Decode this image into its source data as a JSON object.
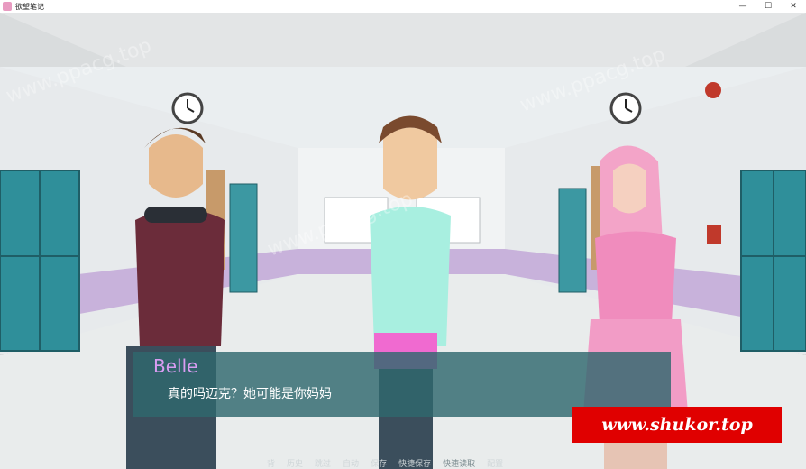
{
  "window": {
    "title": "欲望笔记",
    "controls": [
      "—",
      "☐",
      "✕"
    ]
  },
  "dialogue": {
    "speaker": "Belle",
    "text": "真的吗迈克？她可能是你妈妈"
  },
  "quick_menu": [
    {
      "label": "背",
      "enabled": true
    },
    {
      "label": "历史",
      "enabled": true
    },
    {
      "label": "跳过",
      "enabled": true
    },
    {
      "label": "自动",
      "enabled": true
    },
    {
      "label": "保存",
      "enabled": true
    },
    {
      "label": "快捷保存",
      "enabled": true
    },
    {
      "label": "快速读取",
      "enabled": false
    },
    {
      "label": "配置",
      "enabled": true
    }
  ],
  "watermark_banner": "www.shukor.top",
  "colors": {
    "speaker": "#d99cf2",
    "dialog_box": "#30686e",
    "banner": "#e00000"
  }
}
